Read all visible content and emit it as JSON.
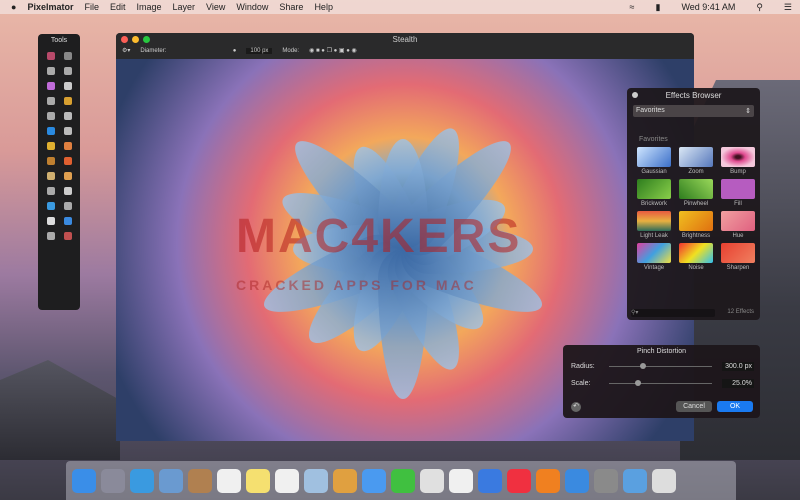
{
  "menubar": {
    "app": "Pixelmator",
    "items": [
      "File",
      "Edit",
      "Image",
      "Layer",
      "View",
      "Window",
      "Share",
      "Help"
    ],
    "clock": "Wed 9:41 AM"
  },
  "tools": {
    "title": "Tools",
    "colors": [
      "#b84a6a",
      "#888",
      "#aaa",
      "#aaa",
      "#c06bd8",
      "#ccc",
      "#aaa",
      "#d8a030",
      "#aaa",
      "#bbb",
      "#2a8ae0",
      "#bbb",
      "#e0b030",
      "#e08040",
      "#c08030",
      "#e06030",
      "#d0b070",
      "#e0a050",
      "#aaa",
      "#ccc",
      "#3a9ae0",
      "#aaa",
      "#ddd",
      "#3a8ae0",
      "#aaa",
      "#c05050"
    ]
  },
  "window": {
    "title": "Stealth",
    "diameter_label": "Diameter:",
    "diameter_value": "100 px",
    "mode_label": "Mode:"
  },
  "watermark": {
    "line1": "MAC4KERS",
    "line2": "CRACKED APPS FOR MAC"
  },
  "effects": {
    "title": "Effects Browser",
    "category": "Favorites",
    "section": "Favorites",
    "count": "12 Effects",
    "items": [
      {
        "label": "Gaussian",
        "color": "linear-gradient(135deg,#cfe6ff,#3b6fc9)"
      },
      {
        "label": "Zoom",
        "color": "linear-gradient(135deg,#dbe8f5,#5577bb)"
      },
      {
        "label": "Bump",
        "color": "radial-gradient(#401020 10%,#e04a90 30%,#f5c8dc 70%)"
      },
      {
        "label": "Brickwork",
        "color": "linear-gradient(135deg,#2e7d1e,#8ad04a)"
      },
      {
        "label": "Pinwheel",
        "color": "linear-gradient(45deg,#2e7d1e,#9ad85a)"
      },
      {
        "label": "Fill",
        "color": "#b65cc0"
      },
      {
        "label": "Light Leak",
        "color": "linear-gradient(180deg,#e85a40,#e8b040,#2c6a5a)"
      },
      {
        "label": "Brightness",
        "color": "linear-gradient(135deg,#f0c020,#e07010)"
      },
      {
        "label": "Hue",
        "color": "linear-gradient(135deg,#f0a0a0,#e06080)"
      },
      {
        "label": "Vintage",
        "color": "linear-gradient(135deg,#e040a0,#40a0e0,#f0e040)"
      },
      {
        "label": "Noise",
        "color": "linear-gradient(135deg,#f03030,#f0e020,#30c0f0)"
      },
      {
        "label": "Sharpen",
        "color": "linear-gradient(135deg,#e84030,#f08060)"
      }
    ]
  },
  "pinch": {
    "title": "Pinch Distortion",
    "radius_label": "Radius:",
    "radius_value": "300.0 px",
    "scale_label": "Scale:",
    "scale_value": "25.0%",
    "cancel": "Cancel",
    "ok": "OK"
  },
  "dock": {
    "colors": [
      "#3a8ee8",
      "#8a8a9a",
      "#3a9ae0",
      "#6a9ad0",
      "#b08050",
      "#f0f0f0",
      "#f5e070",
      "#f0f0f0",
      "#a0c0e0",
      "#e0a040",
      "#4a9af0",
      "#40c040",
      "#e0e0e0",
      "#f0f0f0",
      "#3a7ae0",
      "#f03040",
      "#f08020",
      "#3a8ae0",
      "#8a8a8a",
      "#5aa0e0",
      "#dddddd"
    ]
  }
}
